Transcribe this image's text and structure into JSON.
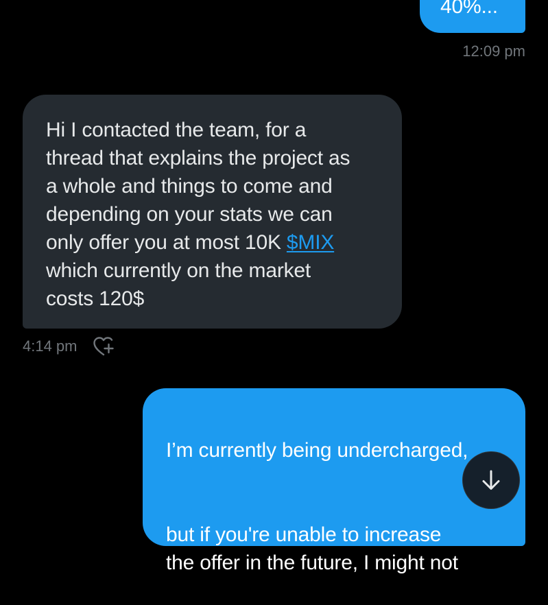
{
  "messages": [
    {
      "direction": "outgoing",
      "text": "40%...",
      "timestamp": "12:09 pm"
    },
    {
      "direction": "incoming",
      "text_before_link": "Hi I contacted the team, for a\nthread that explains the project as\na whole and things to come and\ndepending on your stats we can\nonly offer you at most 10K ",
      "link_text": "$MIX",
      "text_after_link": "\nwhich currently on the market\ncosts 120$",
      "timestamp": "4:14 pm",
      "reaction_icon": "heart-plus-icon"
    },
    {
      "direction": "outgoing",
      "paragraph_1": "I’m currently being undercharged,",
      "paragraph_2": "but if you're unable to increase\nthe offer in the future, I might not"
    }
  ],
  "scroll_button": {
    "icon": "arrow-down-icon"
  },
  "colors": {
    "background": "#000000",
    "outgoing_bubble": "#1d9bf0",
    "incoming_bubble": "#252b31",
    "link": "#1d9bf0",
    "timestamp": "#71767b"
  }
}
